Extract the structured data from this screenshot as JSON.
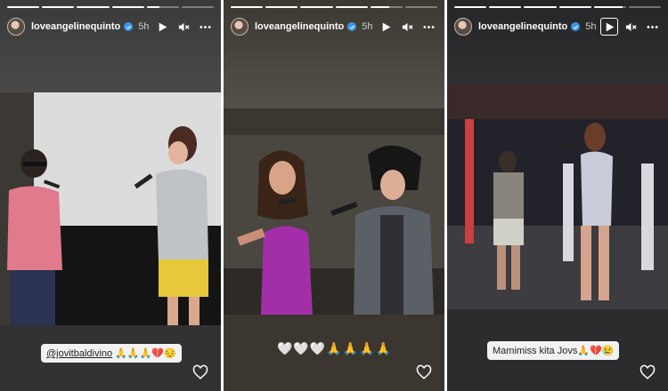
{
  "stories": [
    {
      "username": "loveangelinequinto",
      "time": "5h",
      "progress": [
        1,
        1,
        1,
        1,
        0.4,
        0
      ],
      "caption_mention": "@jovitbaldivino",
      "caption_rest": " 🙏🙏🙏💔😔",
      "play_icon": "play-icon",
      "mute_icon": "mute-icon",
      "more_icon": "more-icon",
      "like_icon": "heart-icon"
    },
    {
      "username": "loveangelinequinto",
      "time": "5h",
      "progress": [
        1,
        1,
        1,
        1,
        0.6,
        0
      ],
      "caption": "🤍🤍🤍🙏🙏🙏🙏",
      "play_icon": "play-icon",
      "mute_icon": "mute-icon",
      "more_icon": "more-icon",
      "like_icon": "heart-icon"
    },
    {
      "username": "loveangelinequinto",
      "time": "5h",
      "progress": [
        1,
        1,
        1,
        1,
        0.9,
        0
      ],
      "caption": "Mamimiss kita Jovs🙏💔😢",
      "play_icon": "play-icon",
      "mute_icon": "mute-icon",
      "more_icon": "more-icon",
      "like_icon": "heart-icon"
    }
  ],
  "colors": {
    "verified": "#3897f0",
    "caption_bg": "#f2f2f2"
  }
}
